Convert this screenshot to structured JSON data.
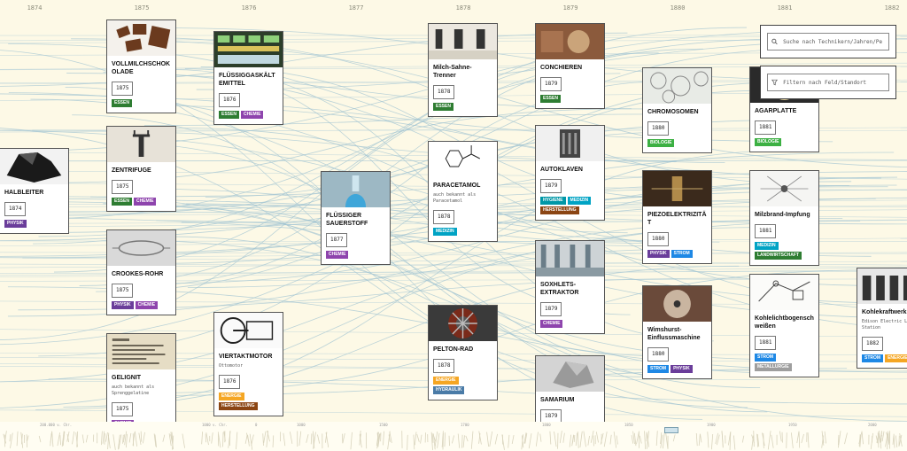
{
  "years": [
    "1874",
    "1875",
    "1876",
    "1877",
    "1878",
    "1879",
    "1880",
    "1881",
    "1882"
  ],
  "tag_colors": {
    "ESSEN": "#2e7d32",
    "CHEMIE": "#8e44ad",
    "PHYSIK": "#6a3d9a",
    "MEDIZIN": "#00a3c4",
    "HYGIENE": "#0097a7",
    "HERSTELLUNG": "#8b4513",
    "BIOLOGIE": "#3cb043",
    "STROM": "#1e88e5",
    "ENERGIE": "#f5a623",
    "HYDRAULIK": "#4a7ba7",
    "LANDWIRTSCHAFT": "#2e7d32",
    "METALLURGIE": "#9e9e9e"
  },
  "cards": [
    {
      "id": "halbleiter",
      "title": "HALBLEITER",
      "subtitle": "",
      "year": "1874",
      "tags": [
        "PHYSIK"
      ],
      "img": "black-crystal"
    },
    {
      "id": "vollmilch",
      "title": "VOLLMILCHSCHOKOLADE",
      "subtitle": "",
      "year": "1875",
      "tags": [
        "ESSEN"
      ],
      "img": "chocolate"
    },
    {
      "id": "zentrifuge",
      "title": "ZENTRIFUGE",
      "subtitle": "",
      "year": "1875",
      "tags": [
        "ESSEN",
        "CHEMIE"
      ],
      "img": "centrifuge"
    },
    {
      "id": "crookes",
      "title": "CROOKES-ROHR",
      "subtitle": "",
      "year": "1875",
      "tags": [
        "PHYSIK",
        "CHEMIE"
      ],
      "img": "tube"
    },
    {
      "id": "gelignit",
      "title": "GELIGNIT",
      "subtitle": "auch bekannt als Sprenggelatine",
      "year": "1875",
      "tags": [
        "CHEMIE"
      ],
      "img": "document"
    },
    {
      "id": "fluessiggas",
      "title": "FLÜSSIGGASKÄLTEMITTEL",
      "subtitle": "",
      "year": "1876",
      "tags": [
        "ESSEN",
        "CHEMIE"
      ],
      "img": "fridge"
    },
    {
      "id": "viertakt",
      "title": "VIERTAKTMOTOR",
      "subtitle": "Ottomotor",
      "year": "1876",
      "tags": [
        "ENERGIE",
        "HERSTELLUNG"
      ],
      "img": "engine"
    },
    {
      "id": "sauerstoff",
      "title": "FLÜSSIGER SAUERSTOFF",
      "subtitle": "",
      "year": "1877",
      "tags": [
        "CHEMIE"
      ],
      "img": "blue-liquid"
    },
    {
      "id": "milch-sahne",
      "title": "Milch-Sahne-Trenner",
      "subtitle": "",
      "year": "1878",
      "tags": [
        "ESSEN"
      ],
      "img": "print"
    },
    {
      "id": "paracetamol",
      "title": "PARACETAMOL",
      "subtitle": "auch bekannt als Paracetamol",
      "year": "1878",
      "tags": [
        "MEDIZIN"
      ],
      "img": "molecule"
    },
    {
      "id": "pelton",
      "title": "PELTON-RAD",
      "subtitle": "",
      "year": "1878",
      "tags": [
        "ENERGIE",
        "HYDRAULIK"
      ],
      "img": "wheel"
    },
    {
      "id": "conchieren",
      "title": "CONCHIEREN",
      "subtitle": "",
      "year": "1879",
      "tags": [
        "ESSEN"
      ],
      "img": "conche"
    },
    {
      "id": "autoklaven",
      "title": "AUTOKLAVEN",
      "subtitle": "",
      "year": "1879",
      "tags": [
        "HYGIENE",
        "MEDIZIN",
        "HERSTELLUNG"
      ],
      "img": "autoclave"
    },
    {
      "id": "soxhlet",
      "title": "SOXHLETS-EXTRAKTOR",
      "subtitle": "",
      "year": "1879",
      "tags": [
        "CHEMIE"
      ],
      "img": "lab"
    },
    {
      "id": "samarium",
      "title": "SAMARIUM",
      "subtitle": "",
      "year": "1879",
      "tags": [],
      "img": "metal"
    },
    {
      "id": "chromosomen",
      "title": "CHROMOSOMEN",
      "subtitle": "",
      "year": "1880",
      "tags": [
        "BIOLOGIE"
      ],
      "img": "cells"
    },
    {
      "id": "piezo",
      "title": "PIEZOELEKTRIZITÄT",
      "subtitle": "",
      "year": "1880",
      "tags": [
        "PHYSIK",
        "STROM"
      ],
      "img": "piezo"
    },
    {
      "id": "wimshurst",
      "title": "Wimshurst-Einflussmaschine",
      "subtitle": "",
      "year": "1880",
      "tags": [
        "STROM",
        "PHYSIK"
      ],
      "img": "wimshurst"
    },
    {
      "id": "agarplatte",
      "title": "AGARPLATTE",
      "subtitle": "",
      "year": "1881",
      "tags": [
        "BIOLOGIE"
      ],
      "img": "agar"
    },
    {
      "id": "milzbrand",
      "title": "Milzbrand-Impfung",
      "subtitle": "",
      "year": "1881",
      "tags": [
        "MEDIZIN",
        "LANDWIRTSCHAFT"
      ],
      "img": "anthrax"
    },
    {
      "id": "kohlelicht",
      "title": "Kohlelichtbogenschweißen",
      "subtitle": "",
      "year": "1881",
      "tags": [
        "STROM",
        "METALLURGIE"
      ],
      "img": "sketch"
    },
    {
      "id": "kohlekraft",
      "title": "Kohlekraftwerk",
      "subtitle": "Edison Electric Light Station",
      "year": "1882",
      "tags": [
        "STROM",
        "ENERGIE"
      ],
      "img": "powerplant"
    }
  ],
  "search": {
    "placeholder": "Suche nach Technikern/Jahren/Pe"
  },
  "filter": {
    "placeholder": "Filtern nach Feld/Standort"
  },
  "minimap": {
    "scale": [
      "200.000 v. Chr.",
      "1000 v. Chr.",
      "0",
      "1000",
      "1500",
      "1700",
      "1800",
      "1850",
      "1900",
      "1950",
      "2000"
    ]
  }
}
